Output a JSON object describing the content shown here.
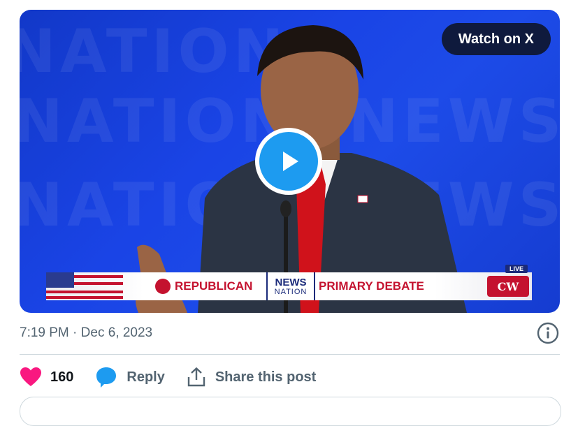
{
  "media": {
    "watch_button_label": "Watch on X",
    "play_button": "play-icon",
    "banner": {
      "live_tag": "LIVE",
      "left_text": "REPUBLICAN",
      "logo_line1": "NEWS",
      "logo_line2": "NATION",
      "right_text": "PRIMARY DEBATE",
      "right_logo": "CW"
    },
    "background_text": [
      "NATION",
      "NEWSNAT",
      "NATION",
      "NEWSNAT"
    ]
  },
  "post": {
    "time": "7:19 PM",
    "separator": "·",
    "date": "Dec 6, 2023"
  },
  "actions": {
    "likes_count": "160",
    "reply_label": "Reply",
    "share_label": "Share this post"
  },
  "colors": {
    "like": "#f91880",
    "reply": "#1d9bf0",
    "muted": "#536471",
    "media_bg": "#1a44e6"
  }
}
